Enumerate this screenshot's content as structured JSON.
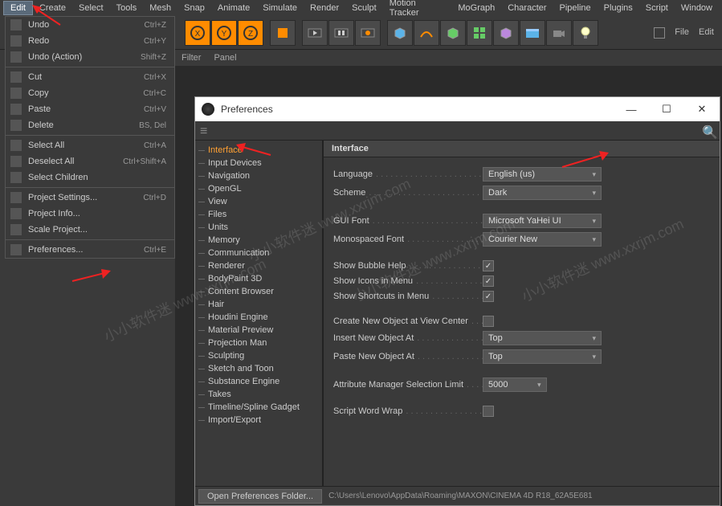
{
  "menubar": [
    "Edit",
    "Create",
    "Select",
    "Tools",
    "Mesh",
    "Snap",
    "Animate",
    "Simulate",
    "Render",
    "Sculpt",
    "Motion Tracker",
    "MoGraph",
    "Character",
    "Pipeline",
    "Plugins",
    "Script",
    "Window"
  ],
  "rightMenu": [
    "File",
    "Edit"
  ],
  "subbar": [
    "Filter",
    "Panel"
  ],
  "editMenu": [
    {
      "label": "Undo",
      "shortcut": "Ctrl+Z",
      "icon": "undo-icon"
    },
    {
      "label": "Redo",
      "shortcut": "Ctrl+Y",
      "icon": "redo-icon"
    },
    {
      "label": "Undo (Action)",
      "shortcut": "Shift+Z",
      "icon": "undo-action-icon"
    },
    "sep",
    {
      "label": "Cut",
      "shortcut": "Ctrl+X",
      "icon": "cut-icon"
    },
    {
      "label": "Copy",
      "shortcut": "Ctrl+C",
      "icon": "copy-icon"
    },
    {
      "label": "Paste",
      "shortcut": "Ctrl+V",
      "icon": "paste-icon"
    },
    {
      "label": "Delete",
      "shortcut": "BS, Del",
      "icon": "delete-icon"
    },
    "sep",
    {
      "label": "Select All",
      "shortcut": "Ctrl+A",
      "icon": "select-all-icon"
    },
    {
      "label": "Deselect All",
      "shortcut": "Ctrl+Shift+A",
      "icon": "deselect-all-icon"
    },
    {
      "label": "Select Children",
      "shortcut": "",
      "icon": "select-children-icon"
    },
    "sep",
    {
      "label": "Project Settings...",
      "shortcut": "Ctrl+D",
      "icon": "project-settings-icon"
    },
    {
      "label": "Project Info...",
      "shortcut": "",
      "icon": "project-info-icon"
    },
    {
      "label": "Scale Project...",
      "shortcut": "",
      "icon": "scale-project-icon"
    },
    "sep",
    {
      "label": "Preferences...",
      "shortcut": "Ctrl+E",
      "icon": "preferences-icon"
    }
  ],
  "prefWindow": {
    "title": "Preferences",
    "sidebar": [
      "Interface",
      "Input Devices",
      "Navigation",
      "OpenGL",
      "View",
      "Files",
      "Units",
      "Memory",
      "Communication",
      "Renderer",
      "BodyPaint 3D",
      "Content Browser",
      "Hair",
      "Houdini Engine",
      "Material Preview",
      "Projection Man",
      "Sculpting",
      "Sketch and Toon",
      "Substance Engine",
      "Takes",
      "Timeline/Spline Gadget",
      "Import/Export"
    ],
    "selectedSidebar": "Interface",
    "header": "Interface",
    "fields": {
      "language_label": "Language",
      "language_value": "English (us)",
      "scheme_label": "Scheme",
      "scheme_value": "Dark",
      "guifont_label": "GUI Font",
      "guifont_value": "Microsoft YaHei UI",
      "monofont_label": "Monospaced Font",
      "monofont_value": "Courier New",
      "bubble_label": "Show Bubble Help",
      "bubble_checked": true,
      "icons_label": "Show Icons in Menu",
      "icons_checked": true,
      "shortcuts_label": "Show Shortcuts in Menu",
      "shortcuts_checked": true,
      "createcenter_label": "Create New Object at View Center",
      "createcenter_checked": false,
      "insertat_label": "Insert New Object At",
      "insertat_value": "Top",
      "pasteat_label": "Paste New Object At",
      "pasteat_value": "Top",
      "attrlimit_label": "Attribute Manager Selection Limit",
      "attrlimit_value": "5000",
      "wordwrap_label": "Script Word Wrap",
      "wordwrap_checked": false
    },
    "footer": {
      "button": "Open Preferences Folder...",
      "path": "C:\\Users\\Lenovo\\AppData\\Roaming\\MAXON\\CINEMA 4D R18_62A5E681"
    }
  },
  "watermarks": [
    "小小软件迷 www.xxrjm.com",
    "小小软件迷 www.xxrjm.com",
    "小小软件迷 www.xxrjm.com",
    "小小软件迷 www.xxrjm.com"
  ]
}
